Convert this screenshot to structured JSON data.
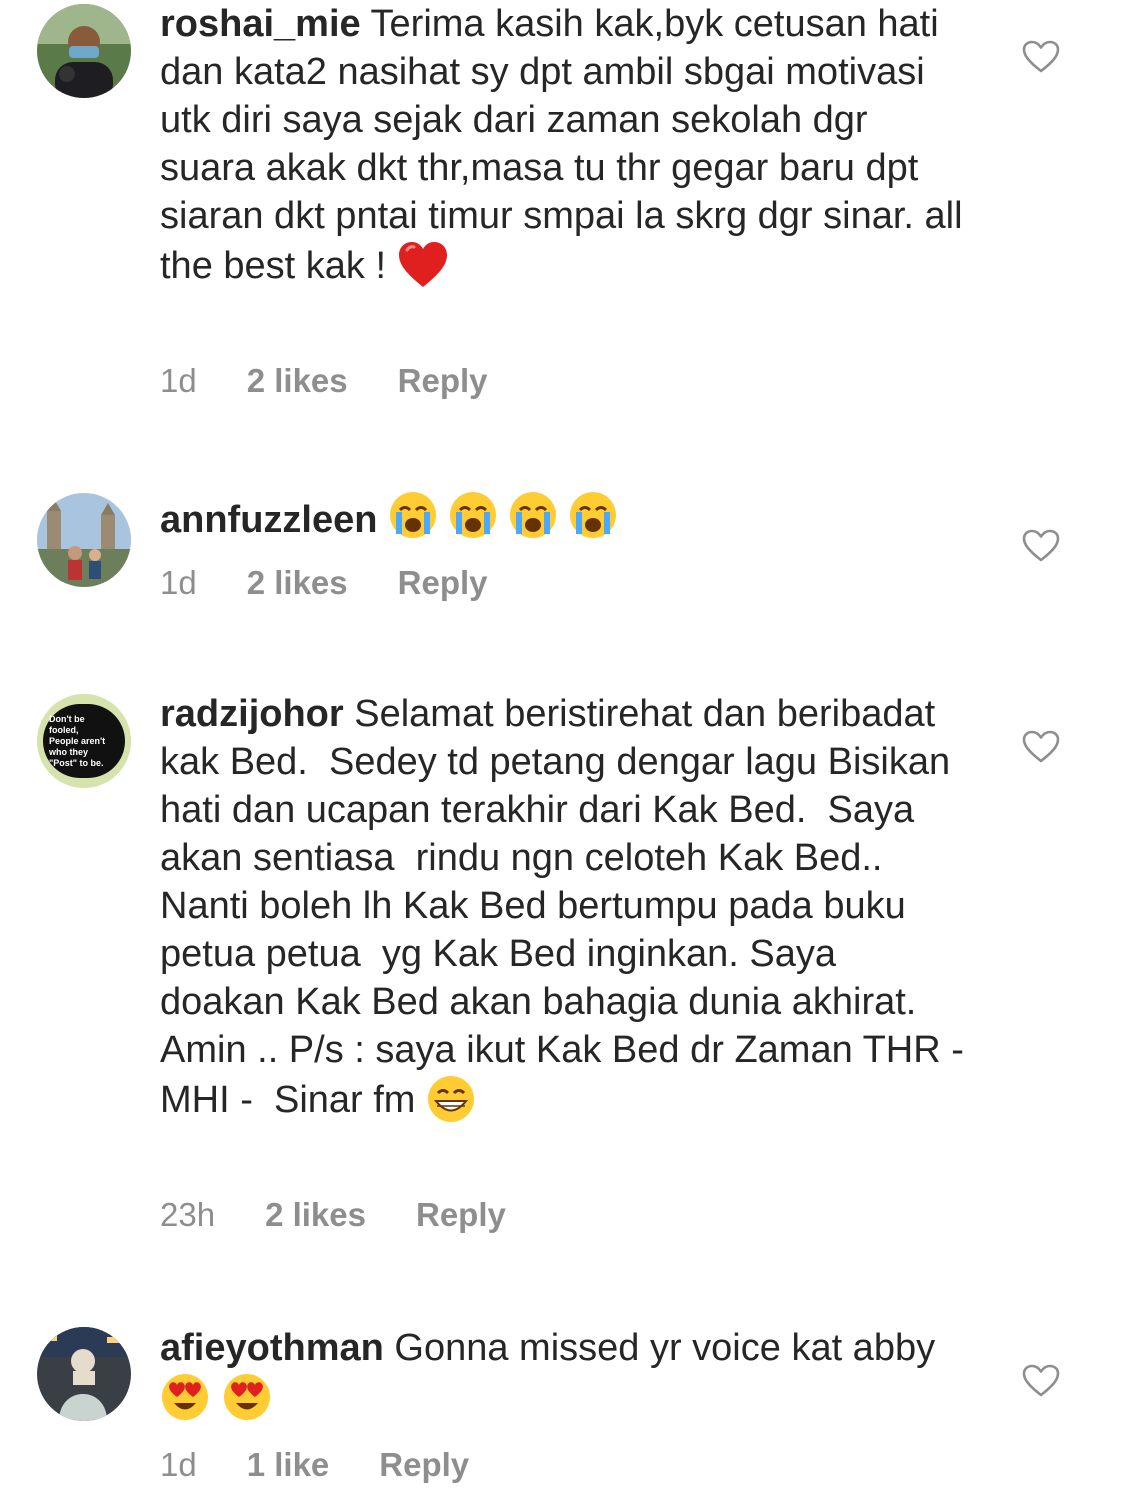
{
  "comments": [
    {
      "username": "roshai_mie",
      "text": " Terima kasih kak,byk cetusan hati dan kata2 nasihat sy dpt ambil sbgai motivasi utk diri saya sejak dari zaman sekolah dgr suara akak dkt thr,masa tu thr gegar baru dpt siaran dkt pntai timur smpai la skrg dgr sinar. all the best kak ! ",
      "emoji": "red-heart",
      "time": "1d",
      "likes": "2 likes",
      "reply": "Reply"
    },
    {
      "username": "annfuzzleen",
      "text": " ",
      "emoji": "crying-face x4",
      "time": "1d",
      "likes": "2 likes",
      "reply": "Reply"
    },
    {
      "username": "radzijohor",
      "text": " Selamat beristirehat dan beribadat kak Bed.  Sedey td petang dengar lagu Bisikan hati dan ucapan terakhir dari Kak Bed.  Saya akan sentiasa  rindu ngn celoteh Kak Bed.. Nanti boleh lh Kak Bed bertumpu pada buku petua petua  yg Kak Bed inginkan. Saya doakan Kak Bed akan bahagia dunia akhirat. Amin .. P/s : saya ikut Kak Bed dr Zaman THR -MHI -  Sinar fm ",
      "avatar_text": "Don't be fooled, People aren't who they \"Post\" to be.",
      "emoji": "grinning-face",
      "time": "23h",
      "likes": "2 likes",
      "reply": "Reply"
    },
    {
      "username": "afieyothman",
      "text": " Gonna missed yr voice kat abby",
      "emoji": "heart-eyes x2",
      "time": "1d",
      "likes": "1 like",
      "reply": "Reply"
    }
  ],
  "colors": {
    "text": "#262626",
    "meta": "#8e8e8e",
    "heart_outline": "#8e8e8e"
  }
}
